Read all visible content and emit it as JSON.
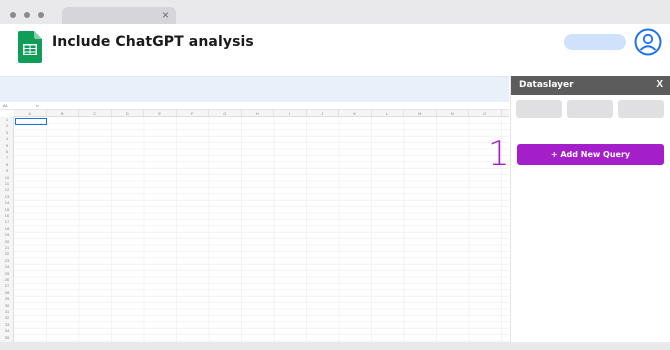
{
  "browser": {
    "tab_close": "×"
  },
  "header": {
    "title": "Include ChatGPT analysis",
    "logo_icon": "google-sheets-icon",
    "avatar_icon": "user-avatar-icon"
  },
  "sheet": {
    "cell_ref": "A1",
    "fx_label": "fx",
    "columns": [
      "A",
      "B",
      "C",
      "D",
      "E",
      "F",
      "G",
      "H",
      "I",
      "J",
      "K",
      "L",
      "M",
      "N",
      "O"
    ],
    "rows": [
      "1",
      "2",
      "3",
      "4",
      "5",
      "6",
      "7",
      "8",
      "9",
      "10",
      "11",
      "12",
      "13",
      "14",
      "15",
      "16",
      "17",
      "18",
      "19",
      "20",
      "21",
      "22",
      "23",
      "24",
      "25",
      "26",
      "27",
      "28",
      "29",
      "30",
      "31",
      "32",
      "33",
      "34",
      "35"
    ]
  },
  "panel": {
    "title": "Dataslayer",
    "close_label": "X",
    "add_query_label": "+ Add New Query",
    "step_number": "1"
  },
  "colors": {
    "accent": "#a41fc9",
    "panel_header": "#5c5c5c",
    "toolbar": "#eaf0f9",
    "sheets_green": "#0f9d58",
    "avatar_blue": "#1a73e8"
  }
}
